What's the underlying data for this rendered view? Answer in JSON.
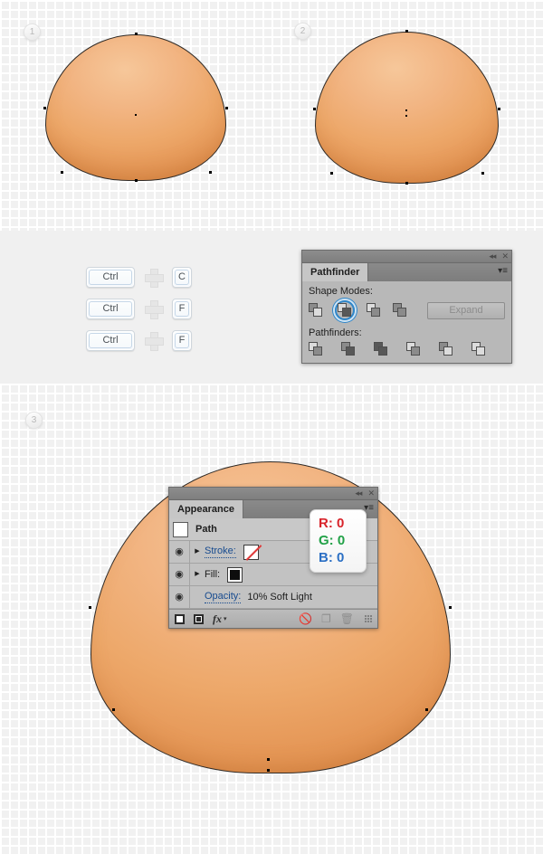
{
  "canvas": {
    "bands": [
      {
        "name": "top",
        "kind": "grid"
      },
      {
        "name": "middle",
        "kind": "plain"
      },
      {
        "name": "bottom",
        "kind": "grid"
      }
    ],
    "grid_color": "#f1f1f1",
    "grid_line_color": "#ffffff",
    "plain_bg": "#f0f0f0"
  },
  "steps": [
    {
      "number": "1"
    },
    {
      "number": "2"
    },
    {
      "number": "3"
    }
  ],
  "shapes": {
    "fill_light": "#f6c79a",
    "fill_mid": "#eda86a",
    "fill_dark": "#e2904f",
    "stroke": "#2f2a26",
    "labels": {
      "shape1": "dome-shape-step1",
      "shape2": "dome-shape-step2",
      "shape3": "dome-shape-step3"
    }
  },
  "shortcuts": {
    "rows": [
      {
        "modifier": "Ctrl",
        "plus": "plus-icon",
        "key": "C"
      },
      {
        "modifier": "Ctrl",
        "plus": "plus-icon",
        "key": "F"
      },
      {
        "modifier": "Ctrl",
        "plus": "plus-icon",
        "key": "F"
      }
    ]
  },
  "pathfinder_panel": {
    "tab": "Pathfinder",
    "titlebar": {
      "collapse": "◂◂",
      "close": "✕"
    },
    "menu_glyph": "▾≡",
    "shape_modes_label": "Shape Modes:",
    "pathfinders_label": "Pathfinders:",
    "expand_label": "Expand",
    "shape_modes": [
      {
        "name": "unite-icon",
        "selected": false
      },
      {
        "name": "minus-front-icon",
        "selected": true
      },
      {
        "name": "intersect-icon",
        "selected": false
      },
      {
        "name": "exclude-icon",
        "selected": false
      }
    ],
    "pathfinders": [
      {
        "name": "divide-icon"
      },
      {
        "name": "trim-icon"
      },
      {
        "name": "merge-icon"
      },
      {
        "name": "crop-icon"
      },
      {
        "name": "outline-icon"
      },
      {
        "name": "minus-back-icon"
      }
    ]
  },
  "appearance_panel": {
    "tab": "Appearance",
    "titlebar": {
      "collapse": "◂◂",
      "close": "✕"
    },
    "menu_glyph": "▾≡",
    "rows": [
      {
        "type": "target",
        "label": "Path",
        "swatch": "white"
      },
      {
        "type": "attr",
        "label": "Stroke:",
        "eye": "◉",
        "arrow": "▶",
        "swatch": "none"
      },
      {
        "type": "attr",
        "label": "Fill:",
        "eye": "◉",
        "arrow": "▶",
        "swatch": "black"
      },
      {
        "type": "opacity",
        "label": "Opacity:",
        "eye": "◉",
        "value": "10% Soft Light"
      }
    ],
    "footer": {
      "add_new_stroke": "add-new-stroke-icon",
      "add_new_fill": "add-new-fill-icon",
      "add_effect": "fx",
      "clear_appearance": "⃠",
      "duplicate_item": "❐",
      "delete_item": "Ὕ1",
      "resize": "resize-grip"
    }
  },
  "rgb_callout": {
    "r": "R: 0",
    "g": "G: 0",
    "b": "B: 0",
    "r_color": "#d8232a",
    "g_color": "#21a147",
    "b_color": "#2b6fc4"
  }
}
